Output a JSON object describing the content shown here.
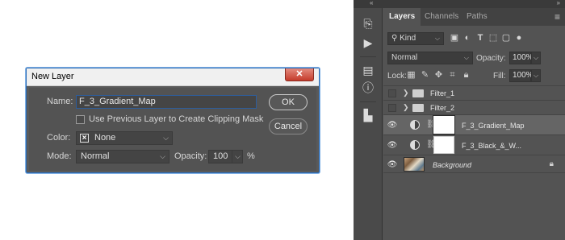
{
  "dialog": {
    "title": "New Layer",
    "close_glyph": "✕",
    "name_label": "Name:",
    "name_value": "F_3_Gradient_Map",
    "clip_label": "Use Previous Layer to Create Clipping Mask",
    "color_label": "Color:",
    "color_value": "None",
    "mode_label": "Mode:",
    "mode_value": "Normal",
    "opacity_label": "Opacity:",
    "opacity_value": "100",
    "opacity_unit": "%",
    "ok_label": "OK",
    "cancel_label": "Cancel"
  },
  "panel": {
    "tabs": [
      {
        "label": "Layers"
      },
      {
        "label": "Channels"
      },
      {
        "label": "Paths"
      }
    ],
    "filter_kind": "Kind",
    "blend_mode": "Normal",
    "opacity_label": "Opacity:",
    "opacity_value": "100%",
    "lock_label": "Lock:",
    "fill_label": "Fill:",
    "fill_value": "100%",
    "layers": [
      {
        "name": "Filter_1",
        "type": "group"
      },
      {
        "name": "Filter_2",
        "type": "group"
      },
      {
        "name": "F_3_Gradient_Map",
        "type": "adjustment",
        "selected": true
      },
      {
        "name": "F_3_Black_&_W...",
        "type": "adjustment"
      },
      {
        "name": "Background",
        "type": "image"
      }
    ]
  },
  "colors": {
    "dialog_bg": "#535353",
    "panel_bg": "#535353",
    "selected_layer": "#656565",
    "dialog_border": "#2e6db5",
    "close_button": "#c43b2b"
  }
}
